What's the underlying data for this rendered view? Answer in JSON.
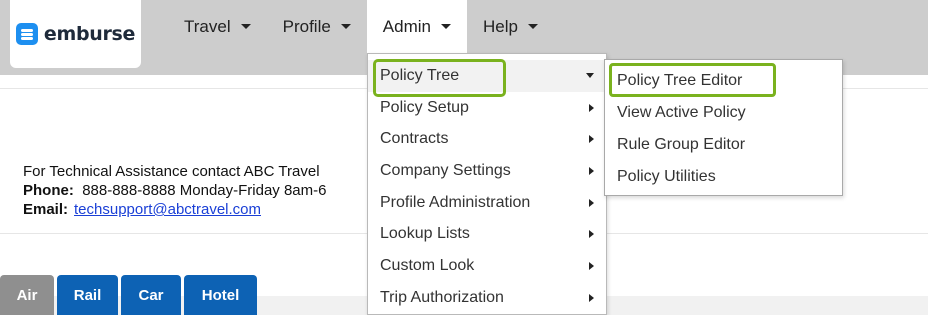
{
  "brand": {
    "name": "emburse",
    "logo_icon": "emburse-logo-icon",
    "accent_color": "#1d8ff0"
  },
  "nav": {
    "items": [
      {
        "label": "Travel"
      },
      {
        "label": "Profile"
      },
      {
        "label": "Admin"
      },
      {
        "label": "Help"
      }
    ]
  },
  "admin_menu": {
    "items": [
      {
        "label": "Policy Tree"
      },
      {
        "label": "Policy Setup"
      },
      {
        "label": "Contracts"
      },
      {
        "label": "Company Settings"
      },
      {
        "label": "Profile Administration"
      },
      {
        "label": "Lookup Lists"
      },
      {
        "label": "Custom Look"
      },
      {
        "label": "Trip Authorization"
      }
    ],
    "highlight_color": "#7ab21e"
  },
  "policy_tree_submenu": {
    "items": [
      {
        "label": "Policy Tree Editor"
      },
      {
        "label": "View Active Policy"
      },
      {
        "label": "Rule Group Editor"
      },
      {
        "label": "Policy Utilities"
      }
    ]
  },
  "assistance": {
    "heading": "For Technical Assistance contact ABC Travel",
    "phone_label": "Phone:",
    "phone_value": "888-888-8888 Monday-Friday 8am-6",
    "email_label": "Email:",
    "email_value": "techsupport@abctravel.com"
  },
  "booking_tabs": {
    "items": [
      {
        "label": "Air"
      },
      {
        "label": "Rail"
      },
      {
        "label": "Car"
      },
      {
        "label": "Hotel"
      }
    ],
    "active_color": "#8f8f8f",
    "tab_color": "#0d62b4"
  }
}
